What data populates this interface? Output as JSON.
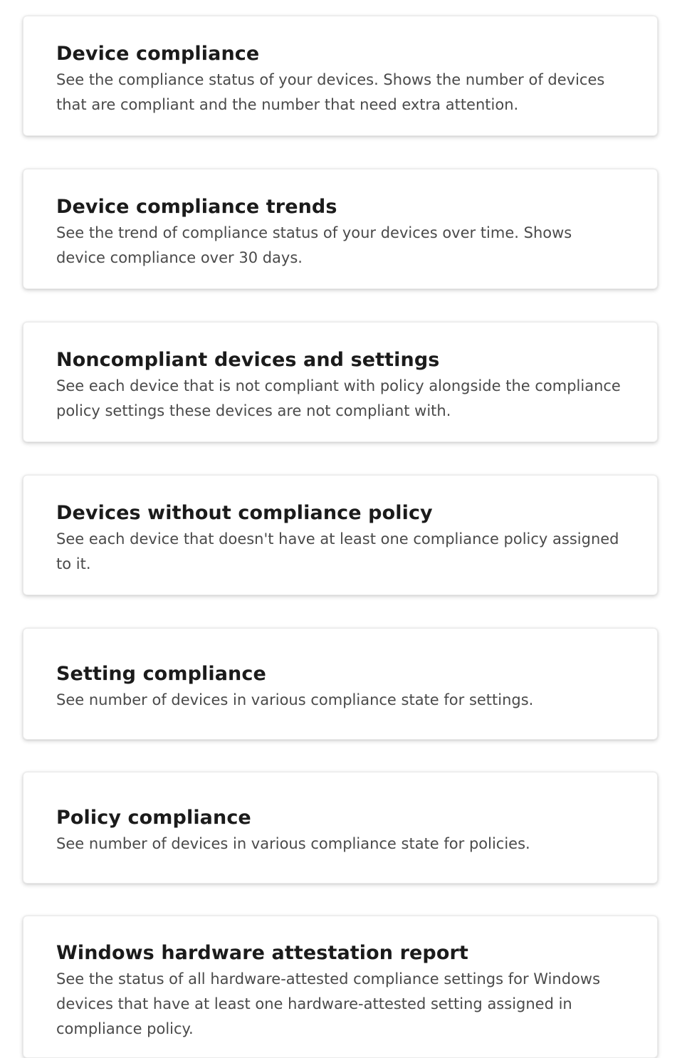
{
  "reports": [
    {
      "title": "Device compliance",
      "description": "See the compliance status of your devices. Shows the number of devices that are compliant and the number that need extra attention."
    },
    {
      "title": "Device compliance trends",
      "description": "See the trend of compliance status of your devices over time. Shows device compliance over 30 days."
    },
    {
      "title": "Noncompliant devices and settings",
      "description": "See each device that is not compliant with policy alongside the compliance policy settings these devices are not compliant with."
    },
    {
      "title": "Devices without compliance policy",
      "description": "See each device that doesn't have at least one compliance policy assigned to it."
    },
    {
      "title": "Setting compliance",
      "description": "See number of devices in various compliance state for settings."
    },
    {
      "title": "Policy compliance",
      "description": "See number of devices in various compliance state for policies."
    },
    {
      "title": "Windows hardware attestation report",
      "description": "See the status of all hardware-attested compliance settings for Windows devices that have at least one hardware-attested setting assigned in compliance policy."
    }
  ]
}
